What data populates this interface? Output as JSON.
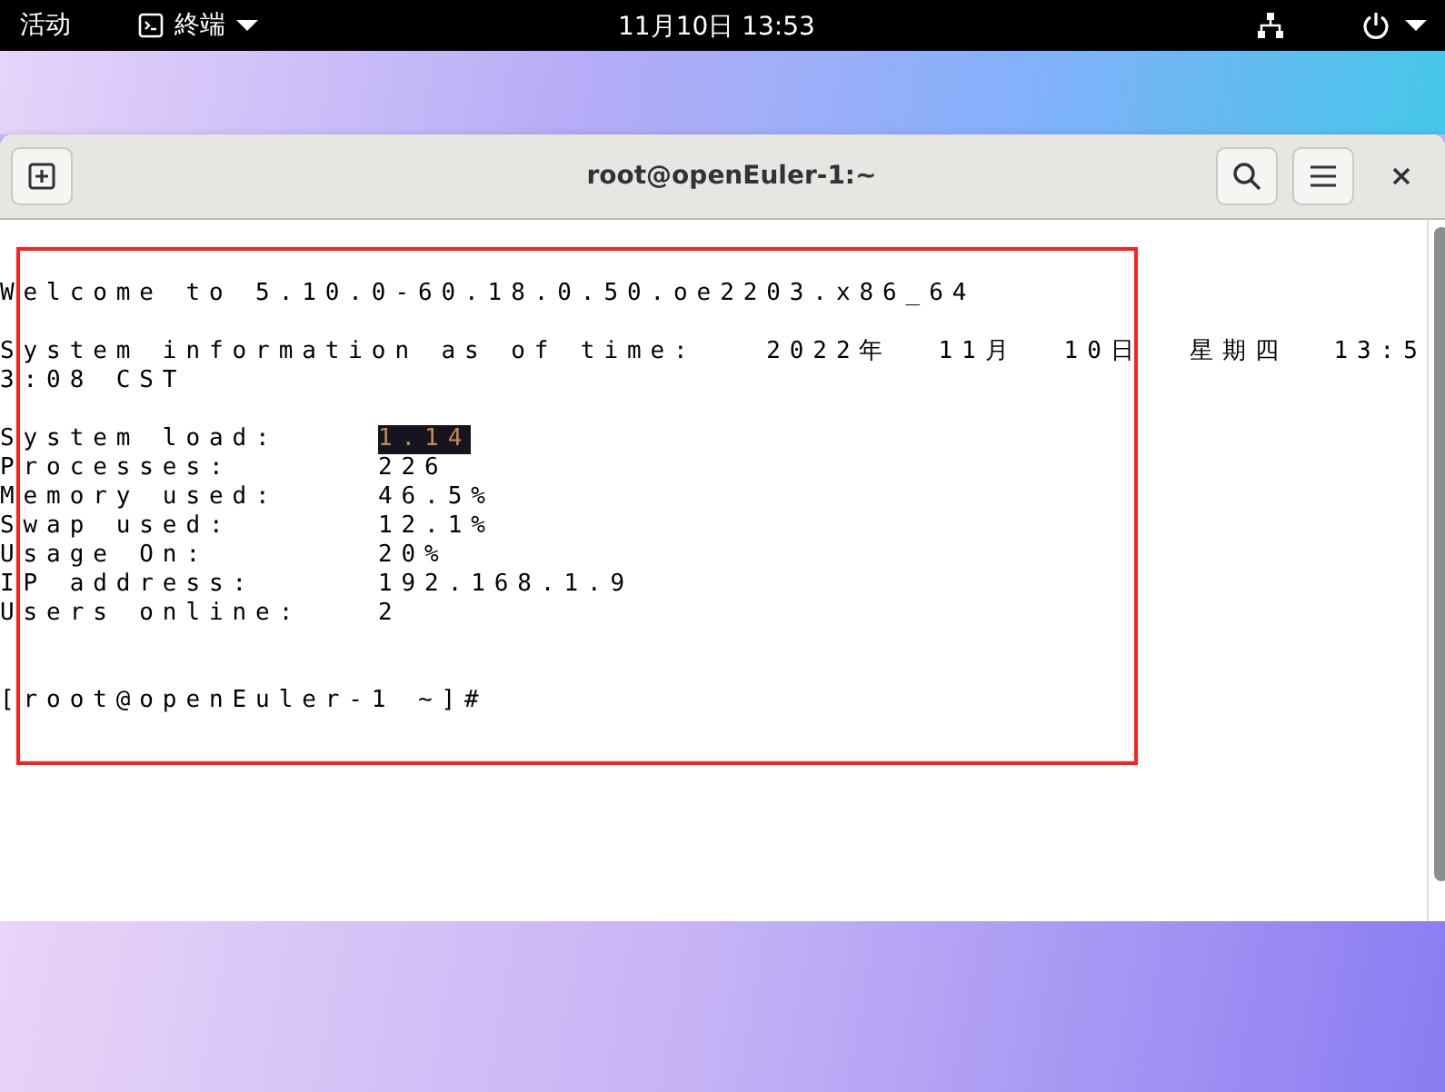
{
  "top_bar": {
    "activities": "活动",
    "app_menu": "終端",
    "clock": "11月10日  13:53"
  },
  "window": {
    "title": "root@openEuler-1:~"
  },
  "terminal": {
    "lines": [
      {
        "kind": "spacer"
      },
      {
        "kind": "text",
        "text": "Welcome to 5.10.0-60.18.0.50.oe2203.x86_64"
      },
      {
        "kind": "spacer"
      },
      {
        "kind": "text",
        "text": "System information as of time:   2022年  11月  10日  星期四  13:5"
      },
      {
        "kind": "text",
        "text": "3:08 CST"
      },
      {
        "kind": "spacer"
      },
      {
        "kind": "stat",
        "label": "System load:",
        "value": "1.14",
        "selected": true
      },
      {
        "kind": "stat",
        "label": "Processes:",
        "value": "226",
        "selected": false
      },
      {
        "kind": "stat",
        "label": "Memory used:",
        "value": "46.5%",
        "selected": false
      },
      {
        "kind": "stat",
        "label": "Swap used:",
        "value": "12.1%",
        "selected": false
      },
      {
        "kind": "stat",
        "label": "Usage On:",
        "value": "20%",
        "selected": false
      },
      {
        "kind": "stat",
        "label": "IP address:",
        "value": "192.168.1.9",
        "selected": false
      },
      {
        "kind": "stat",
        "label": "Users online:",
        "value": "2",
        "selected": false
      },
      {
        "kind": "spacer"
      },
      {
        "kind": "spacer"
      },
      {
        "kind": "text",
        "text": "[root@openEuler-1 ~]#"
      }
    ]
  }
}
